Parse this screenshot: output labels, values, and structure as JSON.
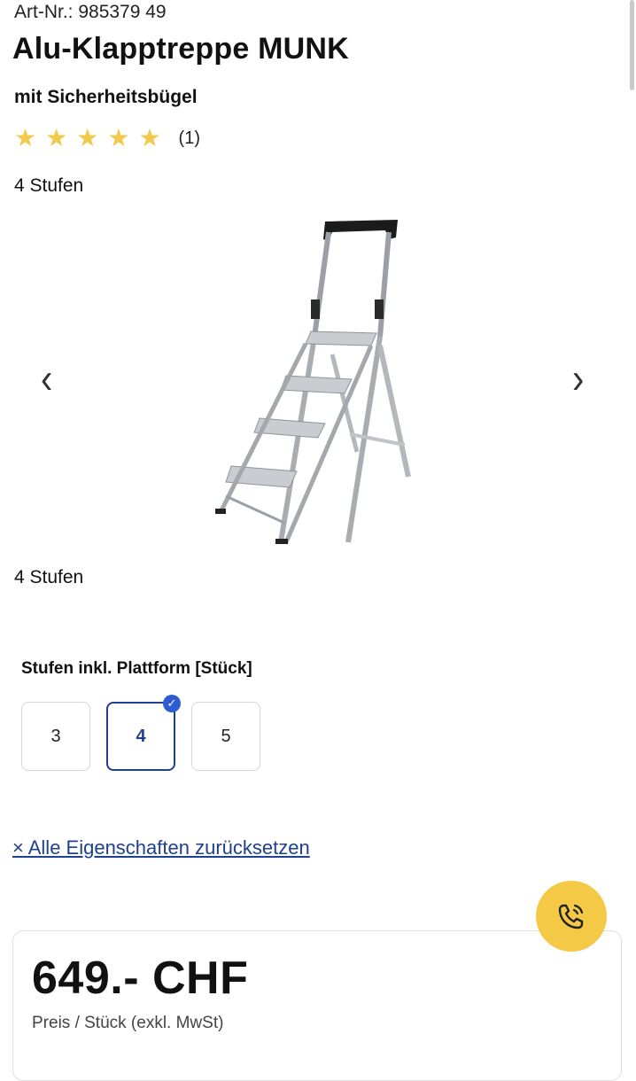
{
  "product": {
    "article_number": "Art-Nr.: 985379 49",
    "title": "Alu-Klapptreppe MUNK",
    "subtitle": "mit Sicherheitsbügel",
    "rating_stars": 5,
    "rating_count": "(1)",
    "variant_heading": "4 Stufen",
    "image_caption": "4 Stufen"
  },
  "gallery": {
    "prev_icon": "‹",
    "next_icon": "›"
  },
  "options": {
    "label": "Stufen inkl. Plattform [Stück]",
    "values": [
      "3",
      "4",
      "5"
    ],
    "selected": "4"
  },
  "reset_link": "× Alle Eigenschaften zurücksetzen",
  "price": {
    "amount": "649.- CHF",
    "note": "Preis / Stück (exkl. MwSt)"
  },
  "colors": {
    "accent": "#1f3f8f",
    "star": "#f2c94c",
    "call_button": "#f3c946"
  }
}
